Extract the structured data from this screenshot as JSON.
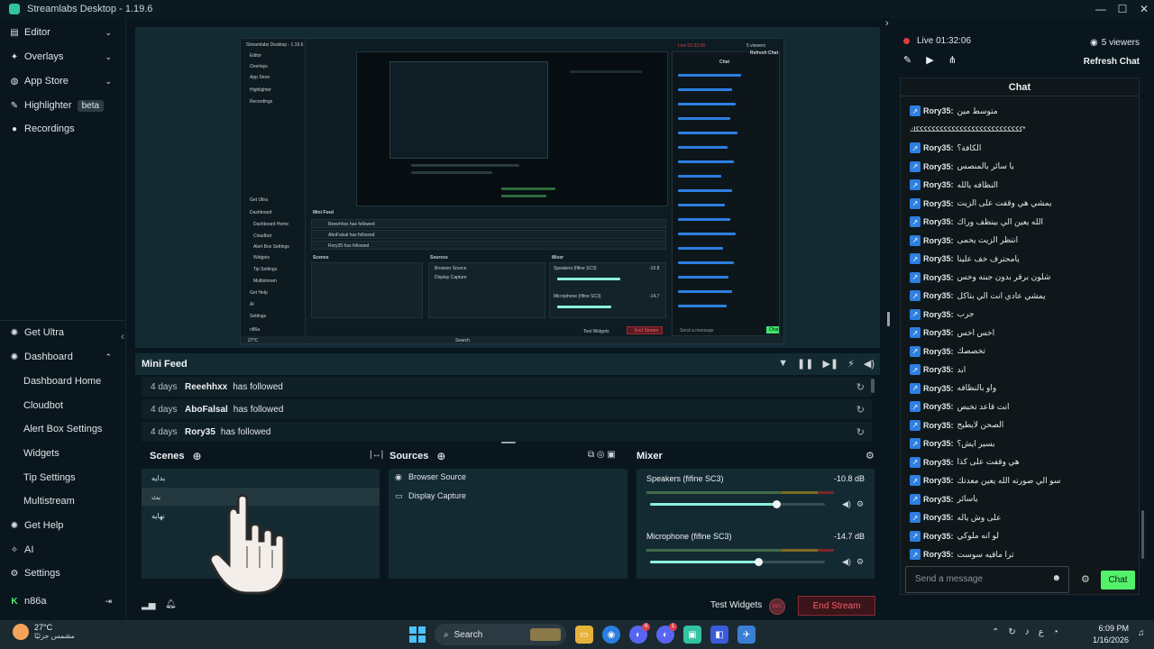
{
  "window": {
    "title": "Streamlabs Desktop - 1.19.6",
    "controls": [
      "—",
      "☐",
      "✕"
    ]
  },
  "sidebar": {
    "top_items": [
      {
        "label": "Editor",
        "icon": "editor-icon",
        "chevron": "⌄"
      },
      {
        "label": "Overlays",
        "icon": "overlays-icon",
        "chevron": "⌄"
      },
      {
        "label": "App Store",
        "icon": "app-store-icon",
        "chevron": "⌄"
      },
      {
        "label": "Highlighter",
        "icon": "highlighter-icon",
        "badge": "beta"
      },
      {
        "label": "Recordings",
        "icon": "recordings-icon"
      }
    ],
    "bottom_items": [
      {
        "label": "Get Ultra",
        "icon": "ultra-icon"
      },
      {
        "label": "Dashboard",
        "icon": "dashboard-icon",
        "chevron": "⌃"
      }
    ],
    "dashboard_sub": [
      "Dashboard Home",
      "Cloudbot",
      "Alert Box Settings",
      "Widgets",
      "Tip Settings",
      "Multistream"
    ],
    "footer_items": [
      {
        "label": "Get Help",
        "icon": "help-icon"
      },
      {
        "label": "AI",
        "icon": "ai-icon"
      },
      {
        "label": "Settings",
        "icon": "settings-icon"
      }
    ],
    "user": {
      "name": "n86a",
      "platform_icon": "kick-icon",
      "logout_icon": "logout-icon"
    }
  },
  "preview": {
    "inner_title": "Streamlabs Desktop - 1.19.6",
    "inner_nav": [
      "Editor",
      "Overlays",
      "App Store",
      "Highlighter",
      "Recordings",
      "Get Ultra",
      "Dashboard",
      "Dashboard Home",
      "Cloudbot",
      "Alert Box Settings",
      "Widgets",
      "Tip Settings",
      "Multistream",
      "Get Help",
      "AI",
      "Settings",
      "n86a"
    ],
    "inner_minifeed": "Mini Feed",
    "inner_feed": [
      "Reeehhxx has followed",
      "AboFalsal has followed",
      "Rory35 has followed"
    ],
    "inner_scenes": "Scenes",
    "inner_sources": "Sources",
    "inner_mixer": "Mixer",
    "inner_source_items": [
      "Browser Source",
      "Display Capture"
    ],
    "inner_mixer_items": [
      "Speakers (fifine SC3)",
      "Microphone (fifine SC3)"
    ],
    "inner_db": [
      "-10.8",
      "-14.7"
    ],
    "inner_chat": "Chat",
    "inner_live": "Live 01:32:06",
    "inner_viewers": "5 viewers",
    "inner_refresh": "Refresh Chat",
    "inner_send": "Send a message",
    "inner_chat_btn": "Chat",
    "inner_test": "Test Widgets",
    "inner_end": "End Stream",
    "inner_search": "Search",
    "inner_weather": "27°C"
  },
  "minifeed": {
    "title": "Mini Feed",
    "tools": [
      "filter-icon",
      "pause-icon",
      "skip-icon",
      "mute-alerts-icon",
      "volume-icon"
    ],
    "rows": [
      {
        "when": "4 days",
        "who": "Reeehhxx",
        "what": "has followed"
      },
      {
        "when": "4 days",
        "who": "AboFalsal",
        "what": "has followed"
      },
      {
        "when": "4 days",
        "who": "Rory35",
        "what": "has followed"
      }
    ]
  },
  "scenes": {
    "title": "Scenes",
    "items": [
      "بدايه",
      "بث",
      "نهايه"
    ],
    "selected_index": 1
  },
  "sources": {
    "title": "Sources",
    "items": [
      {
        "label": "Browser Source",
        "icon": "browser-source-icon"
      },
      {
        "label": "Display Capture",
        "icon": "display-capture-icon"
      }
    ]
  },
  "mixer": {
    "title": "Mixer",
    "channels": [
      {
        "label": "Speakers (fifine SC3)",
        "db": "-10.8 dB",
        "volume": 0.72
      },
      {
        "label": "Microphone (fifine SC3)",
        "db": "-14.7 dB",
        "volume": 0.62
      }
    ]
  },
  "footer": {
    "test_widgets": "Test Widgets",
    "rec": "REC",
    "end_stream": "End Stream"
  },
  "live": {
    "status": "Live 01:32:06",
    "viewers": "5 viewers",
    "refresh": "Refresh Chat"
  },
  "chat": {
    "title": "Chat",
    "messages": [
      {
        "user": "Rory35:",
        "text": "متوسط مين"
      },
      {
        "user": "",
        "text": "*كككككككككككككككككككككككككككك"
      },
      {
        "user": "Rory35:",
        "text": "الكافة؟"
      },
      {
        "user": "Rory35:",
        "text": "يا سائر بالمنصس"
      },
      {
        "user": "Rory35:",
        "text": "النظافه يالله"
      },
      {
        "user": "Rory35:",
        "text": "يمشي هي وقفت على الزيت"
      },
      {
        "user": "Rory35:",
        "text": "الله يعين الي بينظف وراك"
      },
      {
        "user": "Rory35:",
        "text": "انتظر الزيت يحمى"
      },
      {
        "user": "Rory35:",
        "text": "يامحترف خف علينا"
      },
      {
        "user": "Rory35:",
        "text": "شلون برقر بدون جبنه وخس"
      },
      {
        "user": "Rory35:",
        "text": "يمشي عادي انت الي بتاكل"
      },
      {
        "user": "Rory35:",
        "text": "جرب"
      },
      {
        "user": "Rory35:",
        "text": "اخس اخس"
      },
      {
        "user": "Rory35:",
        "text": "تخصصك"
      },
      {
        "user": "Rory35:",
        "text": "ابد"
      },
      {
        "user": "Rory35:",
        "text": "واو بالنظافه"
      },
      {
        "user": "Rory35:",
        "text": "انت قاعد تخبص"
      },
      {
        "user": "Rory35:",
        "text": "الصحن لايطيح"
      },
      {
        "user": "Rory35:",
        "text": "بسير ايش؟"
      },
      {
        "user": "Rory35:",
        "text": "هي وقفت على كذا"
      },
      {
        "user": "Rory35:",
        "text": "سو الي صورته الله يعين معدتك"
      },
      {
        "user": "Rory35:",
        "text": "ياسائر"
      },
      {
        "user": "Rory35:",
        "text": "على وش ياله"
      },
      {
        "user": "Rory35:",
        "text": "لو انه ملوكي"
      },
      {
        "user": "Rory35:",
        "text": "ترا ماقيه سوست"
      }
    ],
    "input_placeholder": "Send a message",
    "send_label": "Chat"
  },
  "taskbar": {
    "weather_temp": "27°C",
    "weather_desc": "مشمس جزئيًا",
    "search": "Search",
    "tray_lang": "ع",
    "time": "6:09 PM",
    "date": "1/16/2026",
    "badges": [
      "4",
      "1"
    ]
  },
  "colors": {
    "bg": "#09161d",
    "panel": "#142a33",
    "accent_green": "#53f06a",
    "end_stream_red": "#f2626d",
    "live_red": "#e13a3f",
    "twitter_blue": "#2d7fe0"
  }
}
